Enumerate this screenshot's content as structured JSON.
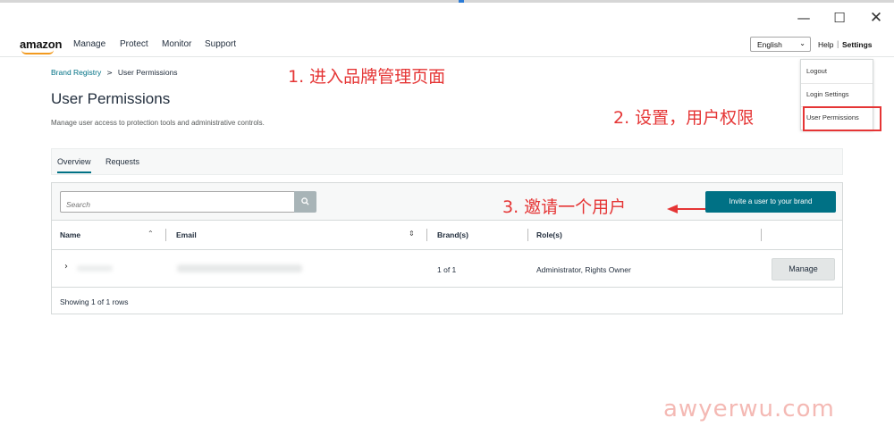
{
  "window": {
    "minimize_glyph": "—",
    "maximize_glyph": "☐",
    "close_glyph": "✕"
  },
  "topnav": {
    "logo_text": "amazon",
    "items": [
      {
        "label": "Manage"
      },
      {
        "label": "Protect"
      },
      {
        "label": "Monitor"
      },
      {
        "label": "Support"
      }
    ],
    "language": "English",
    "help_label": "Help",
    "separator": "|",
    "settings_label": "Settings"
  },
  "settings_menu": {
    "items": [
      {
        "label": "Logout"
      },
      {
        "label": "Login Settings"
      },
      {
        "label": "User Permissions"
      }
    ]
  },
  "breadcrumb": {
    "parent": "Brand Registry",
    "separator": ">",
    "current": "User Permissions"
  },
  "page": {
    "title": "User Permissions",
    "description": "Manage user access to protection tools and administrative controls."
  },
  "tabs": [
    {
      "label": "Overview",
      "active": true
    },
    {
      "label": "Requests",
      "active": false
    }
  ],
  "toolbar": {
    "search_placeholder": "Search",
    "invite_label": "Invite a user to your brand"
  },
  "table": {
    "columns": [
      "Name",
      "Email",
      "Brand(s)",
      "Role(s)"
    ],
    "rows": [
      {
        "name": "",
        "email": "",
        "brands": "1 of 1",
        "roles": "Administrator, Rights Owner",
        "action": "Manage"
      }
    ],
    "footer": "Showing 1 of 1 rows"
  },
  "annotations": {
    "step1": "1. 进入品牌管理页面",
    "step2": "2. 设置，用户权限",
    "step3": "3. 邀请一个用户"
  },
  "watermark": "awyerwu.com",
  "colors": {
    "accent_teal": "#007185",
    "annotation_red": "#e53535",
    "amazon_orange": "#f29a1f"
  }
}
